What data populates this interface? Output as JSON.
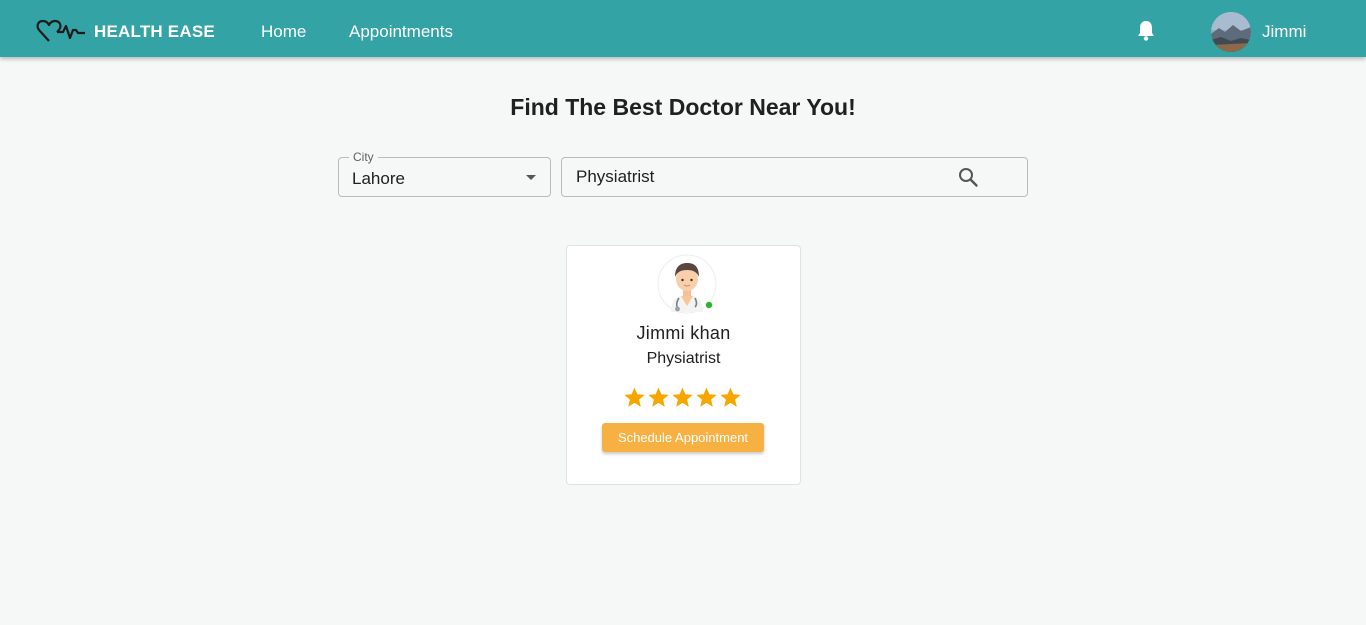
{
  "header": {
    "brand": "HEALTH EASE",
    "nav": [
      {
        "label": "Home"
      },
      {
        "label": "Appointments"
      }
    ],
    "user_name": "Jimmi",
    "icons": {
      "logo": "heartbeat-icon",
      "notifications": "bell-icon",
      "avatar": "user-avatar"
    }
  },
  "main": {
    "title": "Find The Best Doctor Near You!",
    "city": {
      "label": "City",
      "value": "Lahore"
    },
    "search": {
      "value": "Physiatrist",
      "icon": "search-icon"
    }
  },
  "doctors": [
    {
      "name": "Jimmi khan",
      "specialty": "Physiatrist",
      "rating": 5,
      "rating_max": 5,
      "online": true,
      "button_label": "Schedule Appointment"
    }
  ],
  "colors": {
    "header_bg": "#33a3a5",
    "page_bg": "#f6f8f7",
    "accent_button": "#f7b143",
    "star": "#f5a700",
    "online_dot": "#2ab52a"
  }
}
